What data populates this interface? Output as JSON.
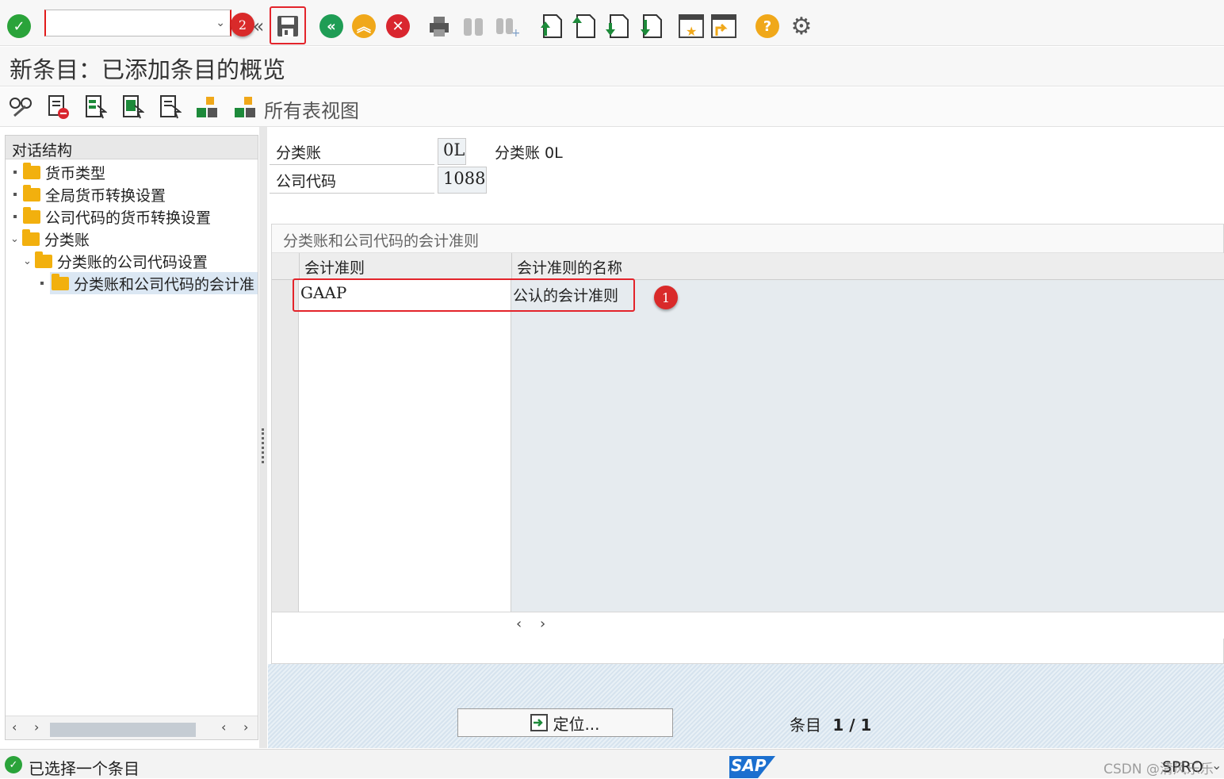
{
  "toolbar": {
    "command_value": "",
    "icons": [
      "check-icon",
      "save-icon",
      "back-icon",
      "exit-icon",
      "cancel-icon",
      "print-icon",
      "find-icon",
      "find-next-icon",
      "first-page-icon",
      "previous-page-icon",
      "next-page-icon",
      "last-page-icon",
      "create-session-icon",
      "shortcut-icon",
      "help-icon",
      "settings-icon"
    ]
  },
  "annotations": {
    "badge_1": "1",
    "badge_2": "2"
  },
  "title": "新条目：已添加条目的概览",
  "app_toolbar": {
    "all_views_label": "所有表视图"
  },
  "dialog_structure": {
    "title": "对话结构",
    "items": [
      {
        "label": "货币类型"
      },
      {
        "label": "全局货币转换设置"
      },
      {
        "label": "公司代码的货币转换设置"
      },
      {
        "label": "分类账"
      },
      {
        "label": "分类账的公司代码设置"
      },
      {
        "label": "分类账和公司代码的会计准"
      }
    ]
  },
  "header_fields": {
    "ledger_label": "分类账",
    "ledger_value": "0L",
    "ledger_desc": "分类账 0L",
    "company_label": "公司代码",
    "company_value": "1088"
  },
  "table": {
    "title": "分类账和公司代码的会计准则",
    "col1": "会计准则",
    "col2": "会计准则的名称",
    "rows": [
      {
        "code": "GAAP",
        "name": "公认的会计准则"
      }
    ]
  },
  "footer": {
    "position_label": "定位...",
    "entry_label": "条目",
    "entry_value": "1 / 1"
  },
  "status": {
    "message": "已选择一个条目",
    "sap_logo": "SAP",
    "transaction": "SPRO",
    "watermark": "CSDN @清风乐乐"
  }
}
